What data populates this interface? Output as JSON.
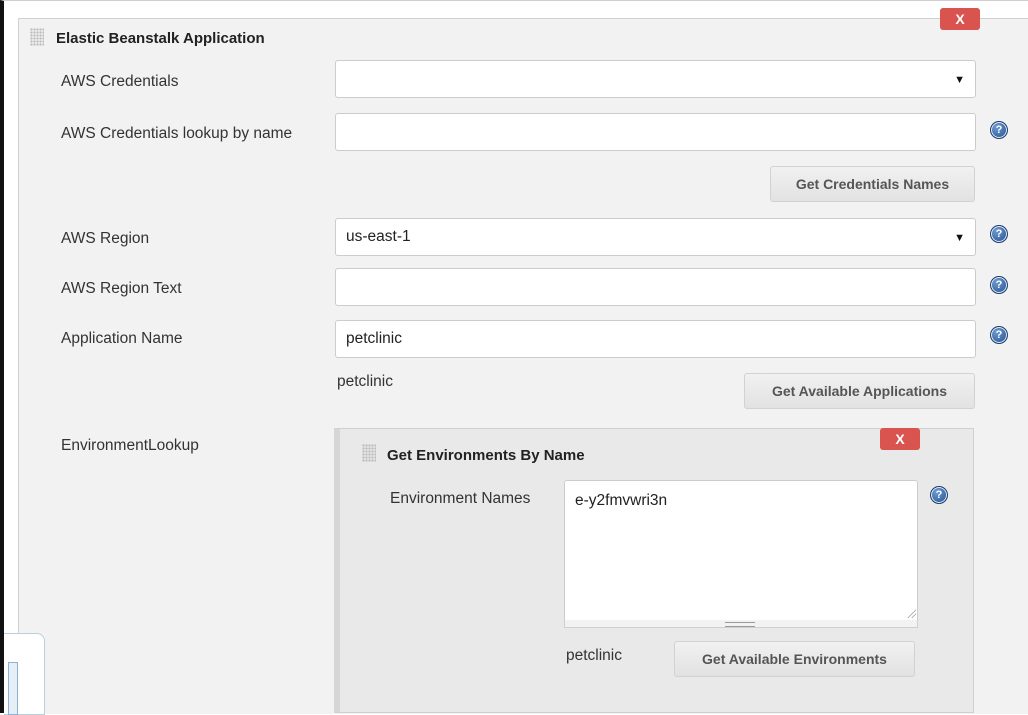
{
  "section": {
    "title": "Elastic Beanstalk Application",
    "close_label": "X"
  },
  "fields": {
    "aws_credentials": {
      "label": "AWS Credentials",
      "value": ""
    },
    "credentials_lookup": {
      "label": "AWS Credentials lookup by name",
      "value": ""
    },
    "get_credentials_button": "Get Credentials Names",
    "aws_region": {
      "label": "AWS Region",
      "value": "us-east-1"
    },
    "aws_region_text": {
      "label": "AWS Region Text",
      "value": ""
    },
    "application_name": {
      "label": "Application Name",
      "value": "petclinic"
    },
    "application_status": "petclinic",
    "get_applications_button": "Get Available Applications",
    "environment_lookup_label": "EnvironmentLookup"
  },
  "environment_panel": {
    "title": "Get Environments By Name",
    "close_label": "X",
    "names_label": "Environment Names",
    "names_value": "e-y2fmvwri3n",
    "status": "petclinic",
    "get_environments_button": "Get Available Environments"
  },
  "help_glyph": "?",
  "dropdown_caret": "▼",
  "icons": [
    "drag-handle-icon",
    "help-icon",
    "chevron-down-icon"
  ],
  "colors": {
    "close": "#d9534f",
    "help": "#1f4f8f",
    "panel": "#f2f2f2"
  }
}
